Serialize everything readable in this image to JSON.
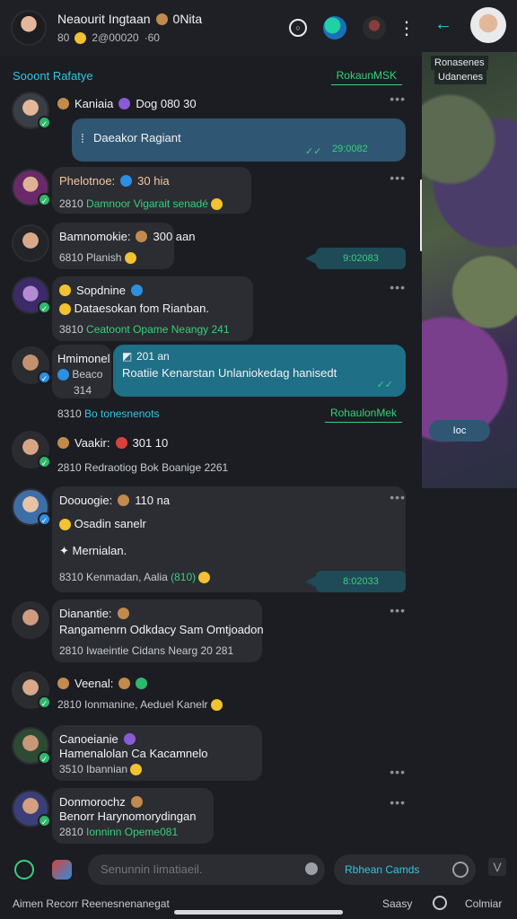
{
  "header": {
    "name": "Neaourit Ingtaan",
    "suffix": "0Nita",
    "status_count": "80",
    "status_text": "2@00020",
    "status_trail": "·60"
  },
  "sections": [
    {
      "left": "Sooont Rafatye",
      "right": "RokaunMSK"
    },
    {
      "left": "",
      "right": "RohaulonMek"
    }
  ],
  "messages": [
    {
      "name": "Kaniaia",
      "extra": "Dog 080 30",
      "time": "",
      "text": "",
      "meta": ""
    },
    {
      "name": "",
      "extra": "",
      "time": "",
      "text": "Daeakor Ragiant",
      "meta": "29:0082"
    },
    {
      "name": "Phelotnoe:",
      "extra": "30 hia",
      "time": "2810",
      "text": "Damnoor Vigarait senadé",
      "meta": ""
    },
    {
      "name": "Bamnomokie:",
      "extra": "300 aan",
      "time": "6810",
      "text": "Planish",
      "meta": ""
    },
    {
      "name": "",
      "extra": "",
      "time": "",
      "text": "",
      "meta": "9:02083"
    },
    {
      "name": "Sopdnine",
      "extra": "",
      "time": "3810",
      "text": "Dataesokan fom Rianban.",
      "meta": "Ceatoont Opame Neangy 241"
    },
    {
      "name": "Hmimonel",
      "extra": "201 an",
      "time": "8310",
      "text": "Beaco",
      "meta": "314"
    },
    {
      "name": "",
      "extra": "",
      "time": "",
      "text": "Roatiie Kenarstan Unlaniokedag hanisedt",
      "meta": ""
    },
    {
      "name": "",
      "extra": "",
      "time": "8310",
      "text": "Bo tonesnenots",
      "meta": ""
    },
    {
      "name": "Vaakir:",
      "extra": "301 10",
      "time": "2810",
      "text": "Redraotiog Bok Boanige 2261",
      "meta": ""
    },
    {
      "name": "Doouogie:",
      "extra": "110 na",
      "time": "8310",
      "text": "Osadin sanelr",
      "meta": "Mernialan."
    },
    {
      "name": "",
      "extra": "",
      "time": "",
      "text": "Kenmadan, Aalia",
      "meta": "(810)"
    },
    {
      "name": "",
      "extra": "",
      "time": "",
      "text": "",
      "meta": "8:02033"
    },
    {
      "name": "Dianantie:",
      "extra": "",
      "time": "2810",
      "text": "Rangamenrn Odkdacy Sam Omtjoadon",
      "meta": "Iwaeintie Cidans Nearg 20 281"
    },
    {
      "name": "Veenal:",
      "extra": "",
      "time": "2810",
      "text": "Ionmanine, Aeduel Kanelr",
      "meta": ""
    },
    {
      "name": "Canoeianie",
      "extra": "",
      "time": "3510",
      "text": "Hamenalolan Ca Kacamnelo",
      "meta": "Ibannian"
    },
    {
      "name": "Donmorochz",
      "extra": "",
      "time": "2810",
      "text": "Benorr Harynomorydingan",
      "meta": "Ionninn Opeme081"
    }
  ],
  "right_panel": {
    "line1": "Ronasenes",
    "line2": "Udanenes",
    "pill": "Ioc"
  },
  "composer": {
    "placeholder": "Senunnin Iimatiaeil.",
    "cta": "Rbhean Camds"
  },
  "footer": {
    "left": "Aimen Recorr Reenesnenanegat",
    "middle": "Saasy",
    "right": "Colmiar"
  }
}
